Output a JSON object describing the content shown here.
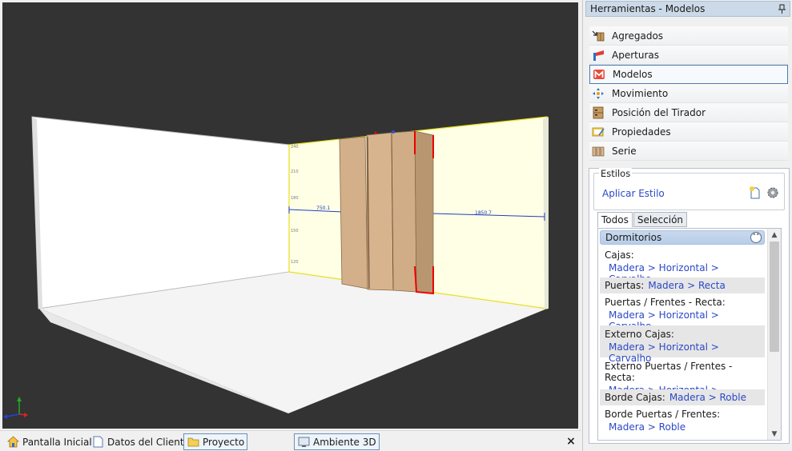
{
  "viewport": {
    "dimension_left": "750.1",
    "dimension_right": "1850.7",
    "wall_ticks": [
      "240",
      "210",
      "180",
      "150",
      "120"
    ]
  },
  "bottom_tabs": [
    {
      "label": "Pantalla Inicial",
      "icon": "home-icon"
    },
    {
      "label": "Datos del Cliente",
      "icon": "document-icon"
    },
    {
      "label": "Proyecto",
      "icon": "folder-icon"
    },
    {
      "label": "Ambiente 3D",
      "icon": "3d-view-icon"
    }
  ],
  "close_label": "×",
  "panel": {
    "title": "Herramientas - Modelos",
    "tools": [
      {
        "label": "Agregados",
        "icon": "add-items-icon"
      },
      {
        "label": "Aperturas",
        "icon": "openings-icon"
      },
      {
        "label": "Modelos",
        "icon": "models-icon"
      },
      {
        "label": "Movimiento",
        "icon": "move-icon"
      },
      {
        "label": "Posición del Tirador",
        "icon": "handle-position-icon"
      },
      {
        "label": "Propiedades",
        "icon": "properties-icon"
      },
      {
        "label": "Serie",
        "icon": "series-icon"
      }
    ],
    "active_tool": "Modelos",
    "styles": {
      "group_label": "Estilos",
      "apply_label": "Aplicar Estilo",
      "tabs": [
        "Todos",
        "Selección"
      ],
      "active_tab": "Todos",
      "group_name": "Dormitorios",
      "properties": [
        {
          "label": "Cajas:",
          "value": "Madera > Horizontal > Carvalho",
          "inline": false,
          "shade": false
        },
        {
          "label": "Puertas:",
          "value": "Madera > Recta",
          "inline": true,
          "shade": true
        },
        {
          "label": "Puertas / Frentes - Recta:",
          "value": "Madera > Horizontal > Carvalho",
          "inline": false,
          "shade": false
        },
        {
          "label": "Externo Cajas:",
          "value": "Madera > Horizontal > Carvalho",
          "inline": false,
          "shade": true
        },
        {
          "label": "Externo Puertas / Frentes - Recta:",
          "value": "Madera > Horizontal > Carvalho",
          "inline": false,
          "shade": false
        },
        {
          "label": "Borde Cajas:",
          "value": "Madera > Roble",
          "inline": true,
          "shade": true
        },
        {
          "label": "Borde Puertas / Frentes:",
          "value": "Madera > Roble",
          "inline": false,
          "shade": false
        }
      ]
    }
  },
  "colors": {
    "viewport_bg": "#333333",
    "wall_back": "#ffffe6",
    "wardrobe": "#d4b08a",
    "link": "#2b48c7",
    "panel_header": "#cbd9e8"
  }
}
